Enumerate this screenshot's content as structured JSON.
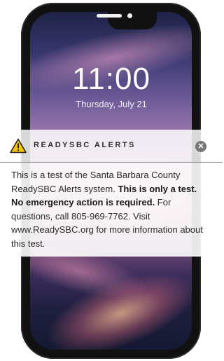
{
  "lock_screen": {
    "time": "11:00",
    "date": "Thursday, July 21"
  },
  "alert": {
    "title": "READYSBC ALERTS",
    "icon": "warning-triangle-icon",
    "close_icon": "close-circle-icon",
    "message": {
      "part1": "This is a test of the Santa Barbara County ReadySBC Alerts system. ",
      "bold": "This is only a test. No emergency action is required.",
      "part2": " For questions, call 805-969-7762. Visit www.ReadySBC.org for more information about this test."
    }
  },
  "colors": {
    "phone_frame": "#111111",
    "alert_title": "#2e2e2e",
    "warning_fill": "#f5c400"
  }
}
